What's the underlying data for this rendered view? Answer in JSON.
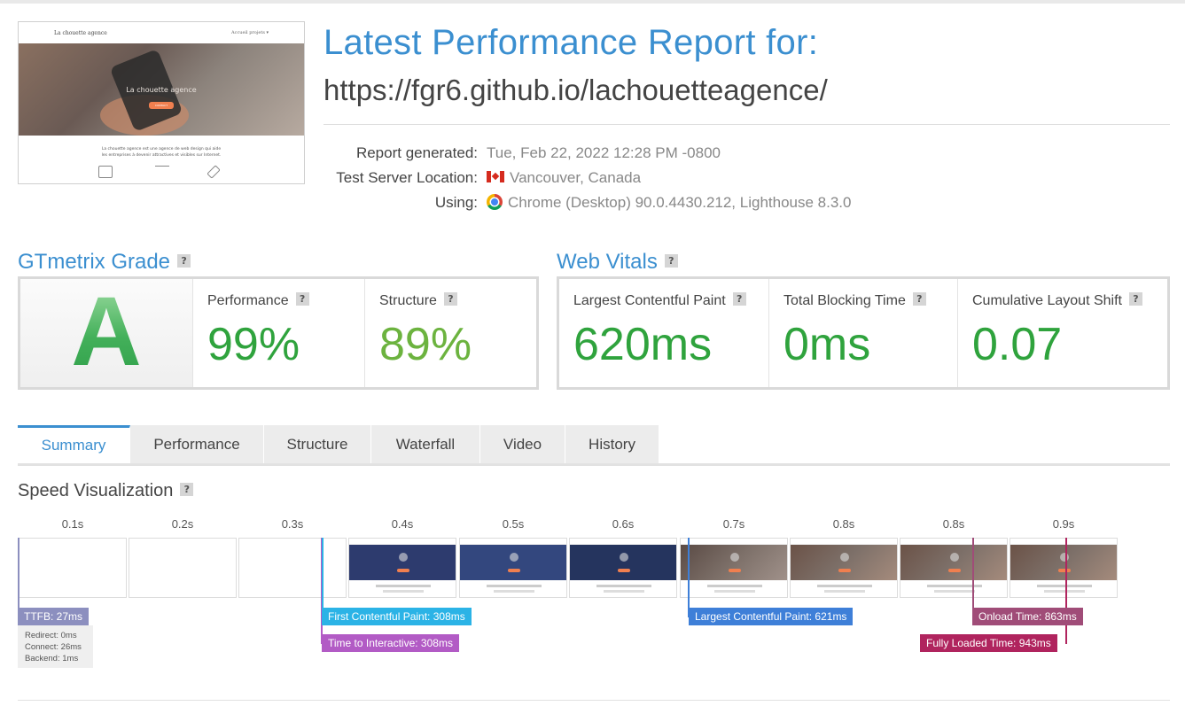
{
  "report": {
    "title": "Latest Performance Report for:",
    "url": "https://fgr6.github.io/lachouetteagence/"
  },
  "thumbnail": {
    "logo": "La chouette agence",
    "nav_links": "Accueil    projets ▾",
    "hero_title": "La chouette agence",
    "hero_button": "CONTACT",
    "text_line1": "La chouette agence est une agence de web design qui aide",
    "text_line2": "les entreprises à devenir attractives et visibles sur Internet."
  },
  "meta": {
    "generated_label": "Report generated:",
    "generated_value": "Tue, Feb 22, 2022 12:28 PM -0800",
    "location_label": "Test Server Location:",
    "location_value": "Vancouver, Canada",
    "using_label": "Using:",
    "using_value": "Chrome (Desktop) 90.0.4430.212, Lighthouse 8.3.0"
  },
  "grade": {
    "heading": "GTmetrix Grade",
    "help": "?",
    "letter": "A",
    "performance_label": "Performance",
    "performance_value": "99%",
    "structure_label": "Structure",
    "structure_value": "89%"
  },
  "vitals": {
    "heading": "Web Vitals",
    "help": "?",
    "lcp_label": "Largest Contentful Paint",
    "lcp_value": "620ms",
    "tbt_label": "Total Blocking Time",
    "tbt_value": "0ms",
    "cls_label": "Cumulative Layout Shift",
    "cls_value": "0.07"
  },
  "tabs": [
    "Summary",
    "Performance",
    "Structure",
    "Waterfall",
    "Video",
    "History"
  ],
  "speed": {
    "heading": "Speed Visualization",
    "help": "?",
    "frame_labels": [
      "0.1s",
      "0.2s",
      "0.3s",
      "0.4s",
      "0.5s",
      "0.6s",
      "0.7s",
      "0.8s",
      "0.8s",
      "0.9s"
    ],
    "markers": {
      "ttfb": "TTFB: 27ms",
      "fcp": "First Contentful Paint: 308ms",
      "tti": "Time to Interactive: 308ms",
      "lcp": "Largest Contentful Paint: 621ms",
      "onload": "Onload Time: 863ms",
      "fully_loaded": "Fully Loaded Time: 943ms"
    },
    "ttfb_detail": {
      "redirect": "Redirect: 0ms",
      "connect": "Connect: 26ms",
      "backend": "Backend: 1ms"
    }
  },
  "colors": {
    "accent": "#3b8fd0",
    "grade_green": "#2fa33d",
    "structure_green": "#6cb33f",
    "ttfb": "#8c8fbf",
    "fcp": "#2bb3e6",
    "tti": "#b25bc5",
    "lcp": "#3e7fd8",
    "onload": "#a04c78",
    "fully_loaded": "#b0245e"
  }
}
